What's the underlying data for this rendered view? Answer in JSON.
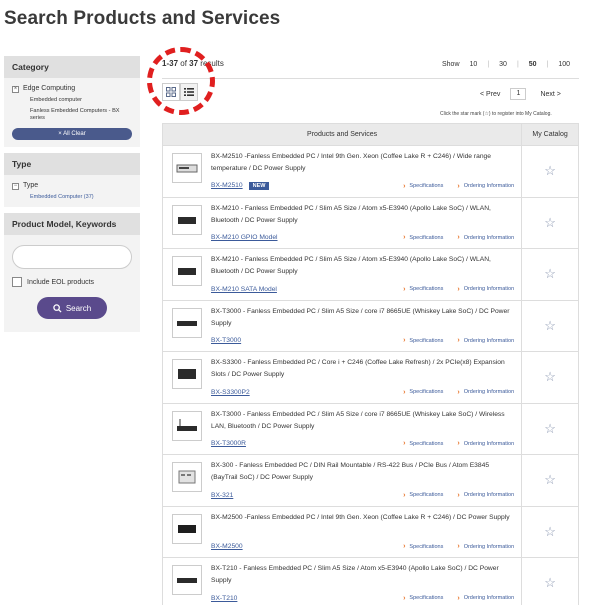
{
  "page": {
    "title": "Search Products and Services"
  },
  "sidebar": {
    "category": {
      "heading": "Category",
      "item": "Edge Computing",
      "sub1": "Embedded computer",
      "sub2": "Fanless Embedded Computers - BX series",
      "all_clear": "× All Clear"
    },
    "type": {
      "heading": "Type",
      "item": "Type",
      "link": "Embedded Computer (37)"
    },
    "keywords": {
      "heading": "Product Model, Keywords",
      "placeholder": "",
      "eol_label": "Include EOL products",
      "search_label": "Search"
    }
  },
  "results": {
    "range": "1-37",
    "of": "of",
    "total": "37",
    "suffix": "results",
    "show_label": "Show",
    "show_options": [
      "10",
      "30",
      "50",
      "100"
    ],
    "show_active": "50",
    "prev": "< Prev",
    "page": "1",
    "next": "Next >",
    "star_note": "Click the star mark (☆) to register into My Catalog."
  },
  "table": {
    "col_products": "Products and Services",
    "col_catalog": "My Catalog",
    "spec_label": "Specifications",
    "order_label": "Ordering Information",
    "rows": [
      {
        "desc": "BX-M2510 -Fanless Embedded PC / Intel 9th Gen. Xeon (Coffee Lake R + C246) / Wide range temperature / DC Power Supply",
        "model": "BX-M2510",
        "badge": "NEW"
      },
      {
        "desc": "BX-M210 - Fanless Embedded PC / Slim A5 Size / Atom x5-E3940 (Apollo Lake SoC) / WLAN, Bluetooth / DC Power Supply",
        "model": "BX-M210 GPIO Model",
        "badge": ""
      },
      {
        "desc": "BX-M210 - Fanless Embedded PC / Slim A5 Size / Atom x5-E3940 (Apollo Lake SoC) / WLAN, Bluetooth / DC Power Supply",
        "model": "BX-M210 SATA Model",
        "badge": ""
      },
      {
        "desc": "BX-T3000 - Fanless Embedded PC / Slim A5 Size / core i7 8665UE (Whiskey Lake SoC) / DC Power Supply",
        "model": "BX-T3000",
        "badge": ""
      },
      {
        "desc": "BX-S3300 - Fanless Embedded PC / Core i + C246 (Coffee Lake Refresh) / 2x PCIe(x8) Expansion Slots / DC Power Supply",
        "model": "BX-S3300P2",
        "badge": ""
      },
      {
        "desc": "BX-T3000 - Fanless Embedded PC / Slim A5 Size / core i7 8665UE (Whiskey Lake SoC) / Wireless LAN, Bluetooth / DC Power Supply",
        "model": "BX-T3000R",
        "badge": ""
      },
      {
        "desc": "BX-300 - Fanless Embedded PC / DIN Rail Mountable / RS-422 Bus / PCIe Bus / Atom E3845 (BayTrail SoC) / DC Power Supply",
        "model": "BX-321",
        "badge": ""
      },
      {
        "desc": "BX-M2500 -Fanless Embedded PC / Intel 9th Gen. Xeon (Coffee Lake R + C246) / DC Power Supply",
        "model": "BX-M2500",
        "badge": ""
      },
      {
        "desc": "BX-T210 - Fanless Embedded PC / Slim A5 Size / Atom x5-E3940 (Apollo Lake SoC) / DC Power Supply",
        "model": "BX-T210",
        "badge": ""
      }
    ]
  },
  "colors": {
    "accent": "#3b5a9a",
    "button": "#5a4a8c",
    "chevron": "#e8742a",
    "highlight": "#e01f1f"
  }
}
